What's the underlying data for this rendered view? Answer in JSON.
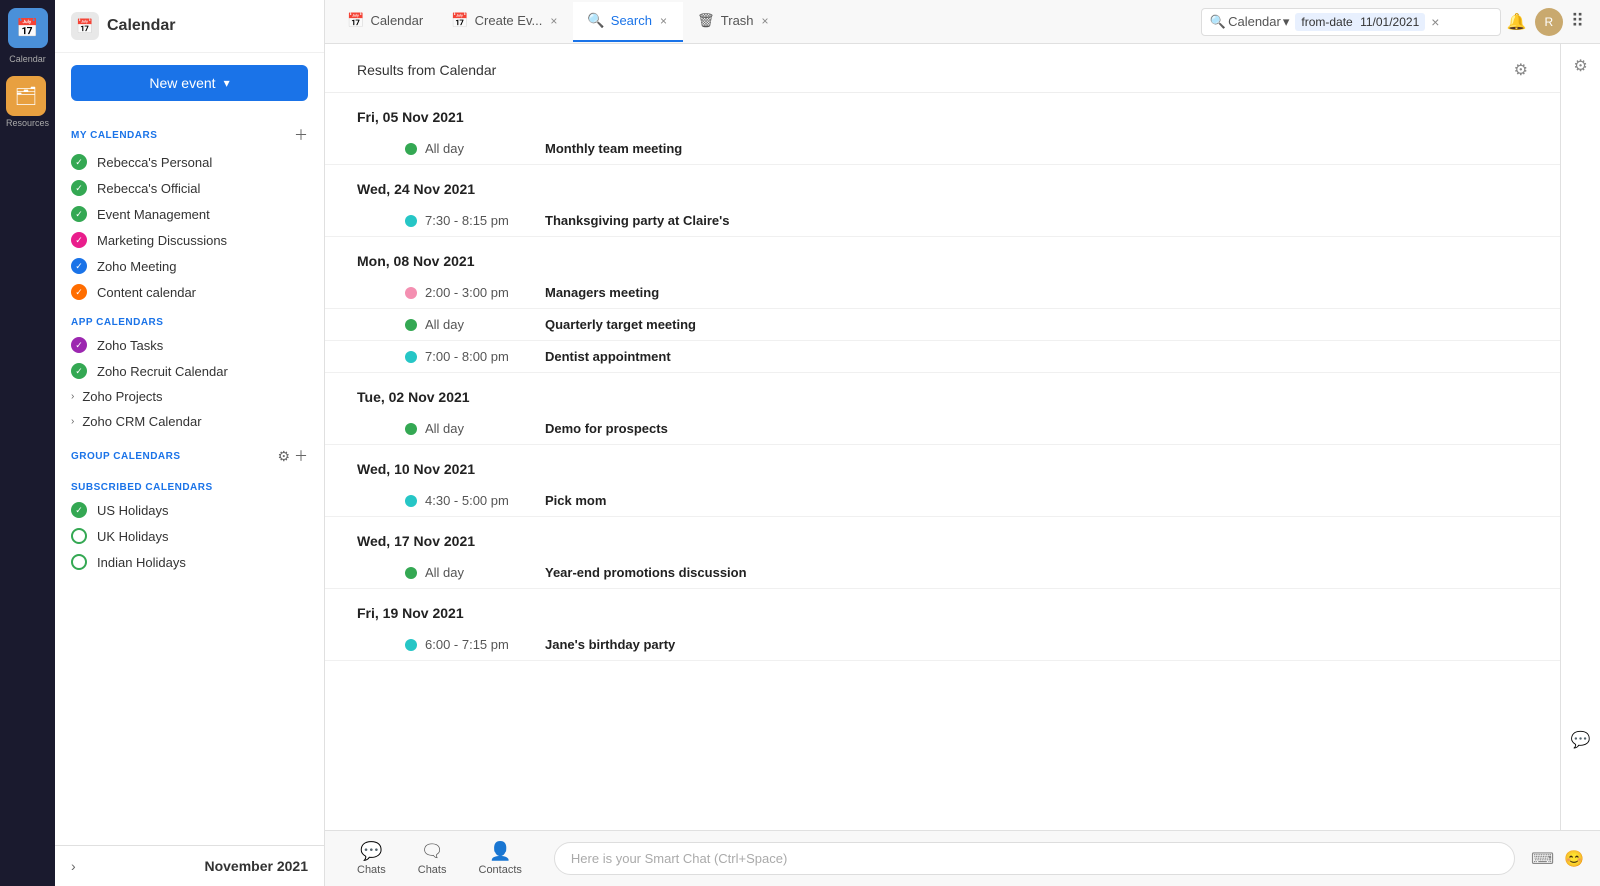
{
  "app": {
    "title": "Calendar",
    "logo": "📅"
  },
  "iconRail": {
    "items": [
      {
        "name": "calendar",
        "icon": "📅",
        "label": "Calendar",
        "active": true
      },
      {
        "name": "resources",
        "icon": "🗂",
        "label": "Resources",
        "active": false
      }
    ]
  },
  "sidebar": {
    "newEventLabel": "New event",
    "myCalendarsLabel": "MY CALENDARS",
    "appCalendarsLabel": "APP CALENDARS",
    "groupCalendarsLabel": "GROUP CALENDARS",
    "subscribedCalendarsLabel": "SUBSCRIBED CALENDARS",
    "myCalendars": [
      {
        "name": "Rebecca's Personal",
        "color": "green",
        "checked": true
      },
      {
        "name": "Rebecca's Official",
        "color": "green",
        "checked": true
      },
      {
        "name": "Event Management",
        "color": "green",
        "checked": true
      },
      {
        "name": "Marketing Discussions",
        "color": "pink",
        "checked": true
      },
      {
        "name": "Zoho Meeting",
        "color": "blue",
        "checked": true
      },
      {
        "name": "Content calendar",
        "color": "orange",
        "checked": true
      }
    ],
    "appCalendars": [
      {
        "name": "Zoho Tasks",
        "color": "purple",
        "checked": true
      },
      {
        "name": "Zoho Recruit Calendar",
        "color": "green",
        "checked": true
      },
      {
        "name": "Zoho Projects",
        "expand": true
      },
      {
        "name": "Zoho CRM Calendar",
        "expand": true
      }
    ],
    "groupCalendars": [],
    "subscribedCalendars": [
      {
        "name": "US Holidays",
        "color": "green",
        "checked": true
      },
      {
        "name": "UK Holidays",
        "color": "green-outline",
        "checked": false
      },
      {
        "name": "Indian Holidays",
        "color": "green-outline",
        "checked": false
      }
    ],
    "monthNav": {
      "label": "November 2021",
      "chevron": "›"
    }
  },
  "tabs": [
    {
      "id": "calendar",
      "label": "Calendar",
      "icon": "📅",
      "closable": false,
      "active": false
    },
    {
      "id": "create-event",
      "label": "Create Ev...",
      "icon": "📅",
      "closable": true,
      "active": false
    },
    {
      "id": "search",
      "label": "Search",
      "icon": "🔍",
      "closable": true,
      "active": true
    },
    {
      "id": "trash",
      "label": "Trash",
      "icon": "🗑",
      "closable": true,
      "active": false
    }
  ],
  "searchBar": {
    "dropdownLabel": "Calendar",
    "fromDateLabel": "from-date",
    "fromDateValue": "11/01/2021",
    "clearIcon": "×"
  },
  "resultsArea": {
    "title": "Results from Calendar",
    "settingsIcon": "⚙",
    "groups": [
      {
        "date": "Fri, 05 Nov 2021",
        "events": [
          {
            "time": "All day",
            "dot": "green",
            "name": "Monthly team meeting"
          }
        ]
      },
      {
        "date": "Wed, 24 Nov 2021",
        "events": [
          {
            "time": "7:30 - 8:15 pm",
            "dot": "teal",
            "name": "Thanksgiving party at Claire's"
          }
        ]
      },
      {
        "date": "Mon, 08 Nov 2021",
        "events": [
          {
            "time": "2:00 - 3:00 pm",
            "dot": "pink",
            "name": "Managers meeting"
          },
          {
            "time": "All day",
            "dot": "green",
            "name": "Quarterly target meeting"
          },
          {
            "time": "7:00 - 8:00 pm",
            "dot": "teal",
            "name": "Dentist appointment"
          }
        ]
      },
      {
        "date": "Tue, 02 Nov 2021",
        "events": [
          {
            "time": "All day",
            "dot": "green",
            "name": "Demo for prospects"
          }
        ]
      },
      {
        "date": "Wed, 10 Nov 2021",
        "events": [
          {
            "time": "4:30 - 5:00 pm",
            "dot": "teal",
            "name": "Pick mom"
          }
        ]
      },
      {
        "date": "Wed, 17 Nov 2021",
        "events": [
          {
            "time": "All day",
            "dot": "green",
            "name": "Year-end promotions discussion"
          }
        ]
      },
      {
        "date": "Fri, 19 Nov 2021",
        "events": [
          {
            "time": "6:00 - 7:15 pm",
            "dot": "teal",
            "name": "Jane's birthday party"
          }
        ]
      }
    ]
  },
  "bottomBar": {
    "items": [
      {
        "label": "Chats",
        "icon": "💬"
      },
      {
        "label": "Chats",
        "icon": "🗨"
      },
      {
        "label": "Contacts",
        "icon": "👤"
      }
    ],
    "smartChatPlaceholder": "Here is your Smart Chat (Ctrl+Space)"
  }
}
